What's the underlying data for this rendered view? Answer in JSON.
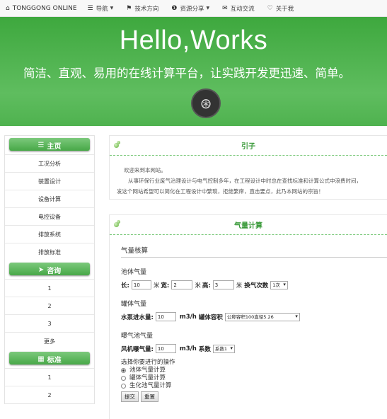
{
  "nav": {
    "brand": "TONGGONG ONLINE",
    "items": [
      {
        "label": "导航",
        "icon": "list-icon",
        "dropdown": true
      },
      {
        "label": "技术方向",
        "icon": "flag-icon",
        "dropdown": false
      },
      {
        "label": "资源分享",
        "icon": "info-circle-icon",
        "dropdown": true
      },
      {
        "label": "互动交流",
        "icon": "envelope-icon",
        "dropdown": false
      },
      {
        "label": "关于我",
        "icon": "heart-icon",
        "dropdown": false
      }
    ]
  },
  "hero": {
    "title": "Hello,Works",
    "subtitle": "简洁、直观、易用的在线计算平台，让实践开发更迅速、简单。",
    "avatar_icon": "fingerprint-icon"
  },
  "sidebar": {
    "sections": [
      {
        "title": "主页",
        "icon": "list-icon",
        "items": [
          "工况分析",
          "装置设计",
          "设备计算",
          "电控设备",
          "排放系统",
          "排放标准"
        ]
      },
      {
        "title": "咨询",
        "icon": "paper-plane-icon",
        "items": [
          "1",
          "2",
          "3",
          "更多"
        ]
      },
      {
        "title": "标准",
        "icon": "grid-icon",
        "items": [
          "1",
          "2"
        ]
      }
    ]
  },
  "intro": {
    "title": "引子",
    "line1": "欢迎来到本网站。",
    "line2": "从事环保行业废气治理设计与电气控制多年，在工程设计中时总在查找标准和计算公式中浪费时间，",
    "line3": "发这个网站希望可以简化在工程设计中繁琐，拒绝繁庠，直击要点，此乃本网站的宗旨！"
  },
  "calc": {
    "title": "气量计算",
    "heading": "气量核算",
    "pool": {
      "label": "池体气量",
      "length_label": "长:",
      "length": "10",
      "unit1": "米",
      "width_label": "宽:",
      "width": "2",
      "unit2": "米",
      "height_label": "高:",
      "height": "3",
      "unit3": "米",
      "exchange_label": "换气次数",
      "exchange": "1次"
    },
    "tank": {
      "label": "罐体气量",
      "pump_label": "水泵进水量:",
      "pump": "10",
      "unit": "m3/h",
      "volume_label": "罐体容积",
      "volume": "公称容积100直径5.26"
    },
    "aeration": {
      "label": "曝气池气量",
      "fan_label": "风机曝气量:",
      "fan": "10",
      "unit": "m3/h",
      "coef_label": "系数",
      "coef": "系数1"
    },
    "ops": {
      "prompt": "选择你要进行的操作",
      "options": [
        "池体气量计算",
        "罐体气量计算",
        "生化池气量计算"
      ],
      "selected": 0
    },
    "buttons": {
      "submit": "提交",
      "reset": "重置"
    }
  }
}
